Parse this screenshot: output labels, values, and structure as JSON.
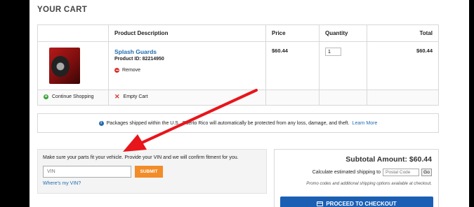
{
  "cart": {
    "title": "YOUR CART",
    "headers": {
      "description": "Product Description",
      "price": "Price",
      "quantity": "Quantity",
      "total": "Total"
    },
    "item": {
      "name": "Splash Guards",
      "product_id": "Product ID: 82214950",
      "remove_label": "Remove",
      "price": "$60.44",
      "quantity": "1",
      "total": "$60.44"
    },
    "actions": {
      "continue": "Continue Shopping",
      "empty": "Empty Cart"
    }
  },
  "notice": {
    "text": "Packages shipped within the U.S.,  Puerto Rico will automatically be protected from any loss, damage, and theft.",
    "link": "Learn More"
  },
  "vin": {
    "prompt": "Make sure your parts fit your vehicle. Provide your VIN and we will confirm fitment for you.",
    "placeholder": "VIN",
    "submit": "SUBMIT",
    "link": "Where's my VIN?"
  },
  "summary": {
    "subtotal": "Subtotal Amount: $60.44",
    "shipping_label": "Calculate estimated shipping to",
    "postal_placeholder": "Postal Code",
    "go": "Go",
    "promo_note": "Promo codes and additional shipping options available at checkout.",
    "checkout": "PROCEED TO CHECKOUT"
  },
  "colors": {
    "accent": "#1f6cb0",
    "submit": "#f28c28",
    "checkout": "#1a5fb4",
    "annotation_arrow": "#e8151b"
  },
  "icons": {
    "remove": "minus-circle-icon",
    "continue": "plus-circle-icon",
    "empty": "x-icon",
    "notice": "info-icon",
    "checkout": "credit-card-icon"
  }
}
